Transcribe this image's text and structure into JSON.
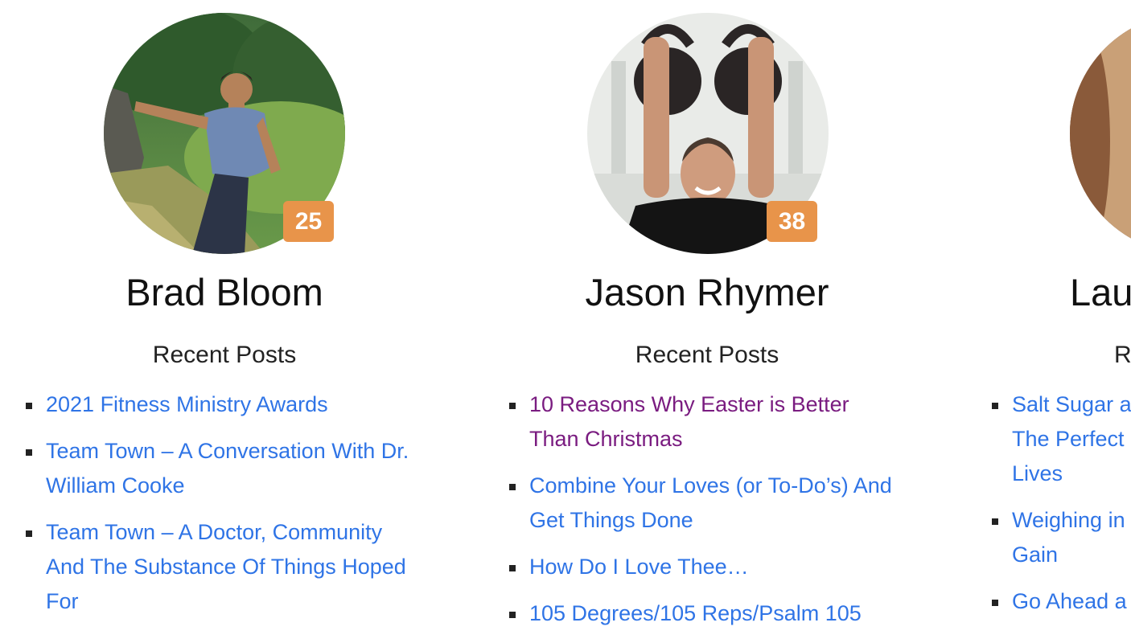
{
  "authors": [
    {
      "name": "Brad Bloom",
      "post_count": "25",
      "recent_heading": "Recent Posts",
      "posts": [
        {
          "title": "2021 Fitness Ministry Awards",
          "visited": false
        },
        {
          "title": "Team Town – A Conversation With Dr. William Cooke",
          "visited": false
        },
        {
          "title": "Team Town – A Doctor, Community And The Substance Of Things Hoped For",
          "visited": false
        }
      ]
    },
    {
      "name": "Jason Rhymer",
      "post_count": "38",
      "recent_heading": "Recent Posts",
      "posts": [
        {
          "title": "10 Reasons Why Easter is Better Than Christmas",
          "visited": true
        },
        {
          "title": "Combine Your Loves (or To-Do’s) And Get Things Done",
          "visited": false
        },
        {
          "title": "How Do I Love Thee…",
          "visited": false
        },
        {
          "title": "105 Degrees/105 Reps/Psalm 105",
          "visited": false
        }
      ]
    },
    {
      "name": "Lau",
      "recent_heading": "R",
      "posts": [
        {
          "title": "Salt Sugar a",
          "visited": false
        },
        {
          "title": "The Perfect",
          "visited": false
        },
        {
          "title": "Lives",
          "visited": false
        },
        {
          "title": "Weighing in",
          "visited": false
        },
        {
          "title": "Gain",
          "visited": false
        },
        {
          "title": "Go Ahead a",
          "visited": false
        }
      ]
    }
  ],
  "colors": {
    "badge": "#e8944a",
    "link": "#2f74e6",
    "link_visited": "#7a1c80"
  }
}
